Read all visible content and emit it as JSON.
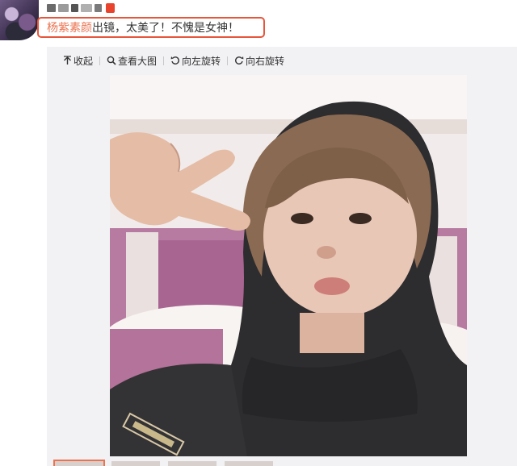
{
  "post": {
    "caption_link": "杨紫素颜",
    "caption_text": "出镜，太美了！不愧是女神！"
  },
  "toolbar": {
    "collapse_label": "收起",
    "view_large_label": "查看大图",
    "rotate_left_label": "向左旋转",
    "rotate_right_label": "向右旋转",
    "collapse_icon": "collapse-up-arrow-icon",
    "view_large_icon": "magnifier-icon",
    "rotate_left_icon": "rotate-left-icon",
    "rotate_right_icon": "rotate-right-icon"
  },
  "colors": {
    "highlight_border": "#e8553a",
    "link": "#eb7350",
    "panel_bg": "#f2f2f5",
    "text": "#333333"
  }
}
